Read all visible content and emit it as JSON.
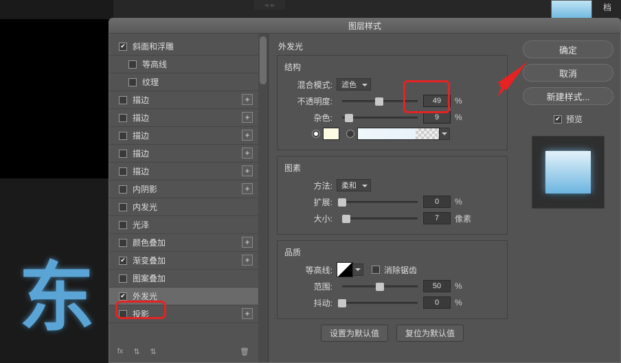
{
  "bg": {
    "right_label": "档",
    "tab_glyph": "‹‹ ››"
  },
  "dialog": {
    "title": "图层样式"
  },
  "effects": [
    {
      "label": "斜面和浮雕",
      "checked": true,
      "plus": false,
      "sub": false
    },
    {
      "label": "等高线",
      "checked": false,
      "plus": false,
      "sub": true
    },
    {
      "label": "纹理",
      "checked": false,
      "plus": false,
      "sub": true
    },
    {
      "label": "描边",
      "checked": false,
      "plus": true,
      "sub": false
    },
    {
      "label": "描边",
      "checked": false,
      "plus": true,
      "sub": false
    },
    {
      "label": "描边",
      "checked": false,
      "plus": true,
      "sub": false
    },
    {
      "label": "描边",
      "checked": false,
      "plus": true,
      "sub": false
    },
    {
      "label": "描边",
      "checked": false,
      "plus": true,
      "sub": false
    },
    {
      "label": "内阴影",
      "checked": false,
      "plus": true,
      "sub": false
    },
    {
      "label": "内发光",
      "checked": false,
      "plus": false,
      "sub": false
    },
    {
      "label": "光泽",
      "checked": false,
      "plus": false,
      "sub": false
    },
    {
      "label": "颜色叠加",
      "checked": false,
      "plus": true,
      "sub": false
    },
    {
      "label": "渐变叠加",
      "checked": true,
      "plus": true,
      "sub": false
    },
    {
      "label": "图案叠加",
      "checked": false,
      "plus": false,
      "sub": false
    },
    {
      "label": "外发光",
      "checked": true,
      "plus": false,
      "sub": false,
      "selected": true
    },
    {
      "label": "投影",
      "checked": false,
      "plus": true,
      "sub": false
    }
  ],
  "toolbar": {
    "fx": "fx"
  },
  "panel_title": "外发光",
  "struct": {
    "legend": "结构",
    "blend_label": "混合模式:",
    "blend_value": "滤色",
    "opacity_label": "不透明度:",
    "opacity_value": "49",
    "opacity_unit": "%",
    "noise_label": "杂色:",
    "noise_value": "9",
    "noise_unit": "%",
    "swatch_color": "#fdfbe2"
  },
  "elements": {
    "legend": "图素",
    "method_label": "方法:",
    "method_value": "柔和",
    "spread_label": "扩展:",
    "spread_value": "0",
    "spread_unit": "%",
    "size_label": "大小:",
    "size_value": "7",
    "size_unit": "像素"
  },
  "quality": {
    "legend": "品质",
    "contour_label": "等高线:",
    "antialias_label": "消除锯齿",
    "range_label": "范围:",
    "range_value": "50",
    "range_unit": "%",
    "jitter_label": "抖动:",
    "jitter_value": "0",
    "jitter_unit": "%"
  },
  "buttons": {
    "make_default": "设置为默认值",
    "reset_default": "复位为默认值"
  },
  "right": {
    "ok": "确定",
    "cancel": "取消",
    "new_style": "新建样式...",
    "preview": "预览"
  },
  "bg_text": "东"
}
